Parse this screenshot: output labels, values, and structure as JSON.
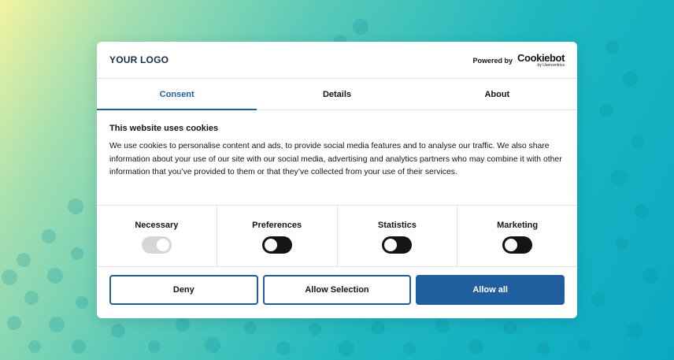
{
  "header": {
    "logo_text": "YOUR LOGO",
    "powered_by": "Powered by",
    "brand_name": "Cookiebot",
    "brand_sub": "by Usercentrics"
  },
  "tabs": [
    {
      "label": "Consent",
      "active": true
    },
    {
      "label": "Details",
      "active": false
    },
    {
      "label": "About",
      "active": false
    }
  ],
  "content": {
    "title": "This website uses cookies",
    "body": "We use cookies to personalise content and ads, to provide social media features and to analyse our traffic. We also share information about your use of our site with our social media, advertising and analytics partners who may combine it with other information that you’ve provided to them or that they’ve collected from your use of their services."
  },
  "toggles": [
    {
      "label": "Necessary",
      "state": "on-disabled"
    },
    {
      "label": "Preferences",
      "state": "off"
    },
    {
      "label": "Statistics",
      "state": "off"
    },
    {
      "label": "Marketing",
      "state": "off"
    }
  ],
  "buttons": {
    "deny": "Deny",
    "allow_selection": "Allow Selection",
    "allow_all": "Allow all"
  },
  "colors": {
    "accent": "#1f5fa0",
    "text": "#141414",
    "logo": "#142f4c",
    "toggle_off": "#141414",
    "toggle_disabled": "#d6d6d6"
  }
}
